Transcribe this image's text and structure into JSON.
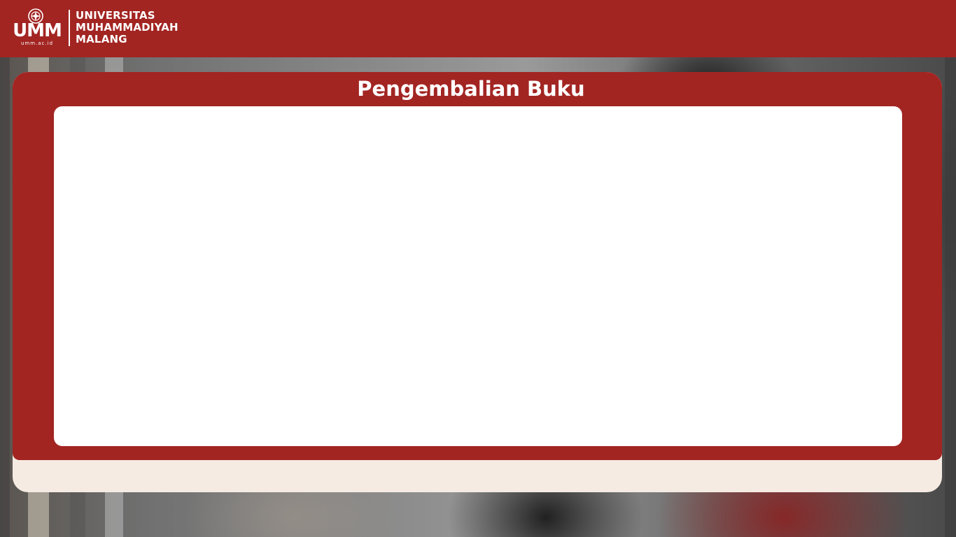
{
  "header": {
    "logo": {
      "wordmark": "UMM",
      "url": "umm.ac.id",
      "name_lines": [
        "UNIVERSITAS",
        "MUHAMMADIYAH",
        "MALANG"
      ]
    }
  },
  "main": {
    "title": "Pengembalian Buku"
  },
  "colors": {
    "brand_red": "#a22522",
    "panel_white": "#ffffff",
    "card_cream": "#f5ebe3"
  }
}
